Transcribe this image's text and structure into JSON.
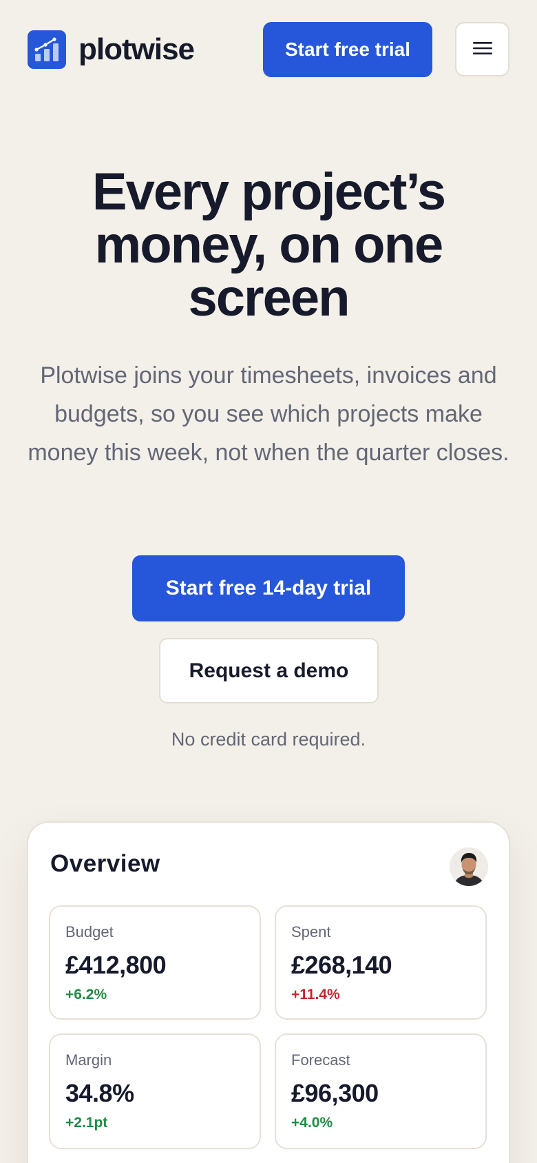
{
  "header": {
    "logo_text": "plotwise",
    "trial_button": "Start free trial",
    "menu_icon": "hamburger-menu-icon"
  },
  "hero": {
    "title": "Every project’s money, on one screen",
    "subtitle": "Plotwise joins your timesheets, invoices and budgets, so you see which projects make money this week, not when the quarter closes.",
    "primary_cta": "Start free 14-day trial",
    "secondary_cta": "Request a demo",
    "note": "No credit card required."
  },
  "overview": {
    "title": "Overview",
    "stats": [
      {
        "label": "Budget",
        "value": "£412,800",
        "delta": "+6.2%",
        "delta_tone": "positive"
      },
      {
        "label": "Spent",
        "value": "£268,140",
        "delta": "+11.4%",
        "delta_tone": "negative"
      },
      {
        "label": "Margin",
        "value": "34.8%",
        "delta": "+2.1pt",
        "delta_tone": "positive"
      },
      {
        "label": "Forecast",
        "value": "£96,300",
        "delta": "+4.0%",
        "delta_tone": "positive"
      }
    ]
  },
  "colors": {
    "brand": "#2656d9",
    "background": "#f3efe9",
    "text": "#161a2b",
    "muted": "#636775",
    "positive": "#1f8a45",
    "negative": "#c0272d"
  }
}
